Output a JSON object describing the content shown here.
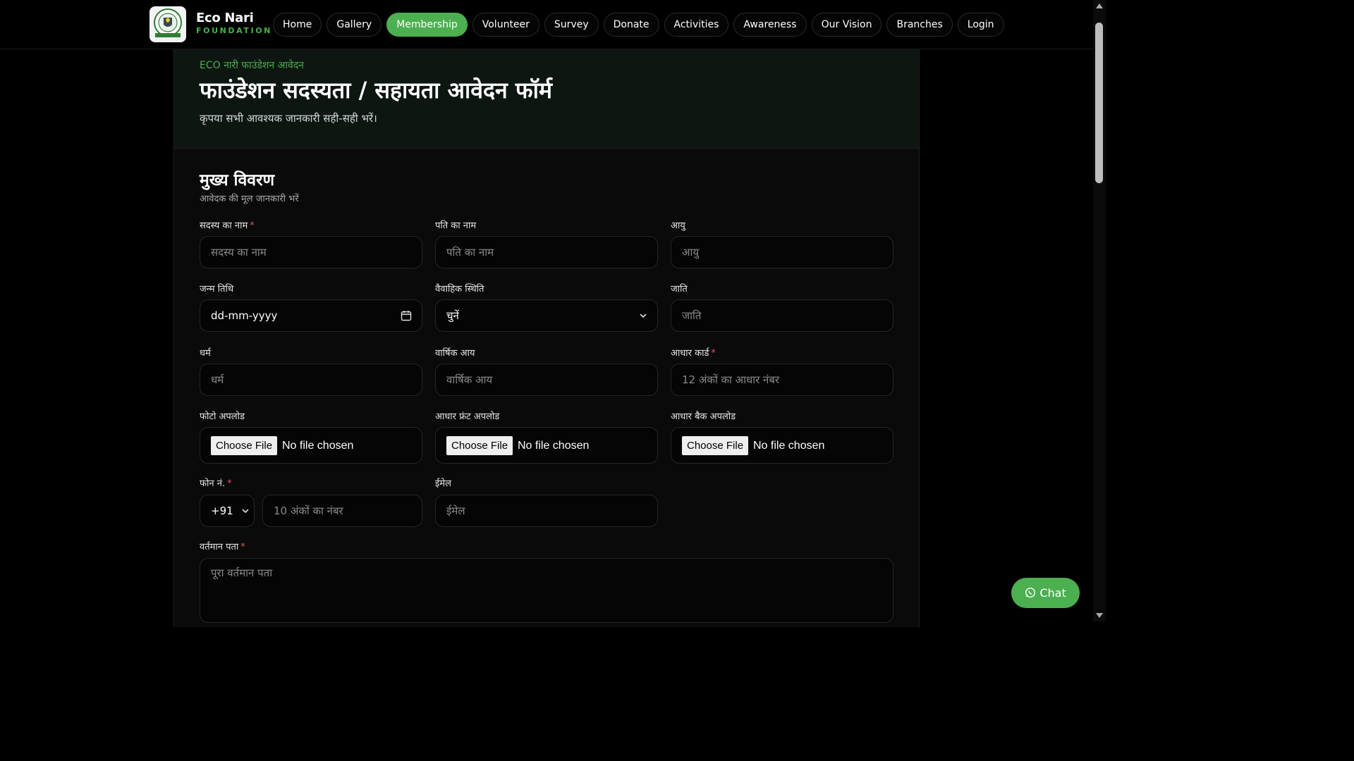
{
  "brand": {
    "name": "Eco Nari",
    "sub": "FOUNDATION",
    "accent": "#4caf50"
  },
  "nav": [
    {
      "label": "Home"
    },
    {
      "label": "Gallery"
    },
    {
      "label": "Membership",
      "active": true
    },
    {
      "label": "Volunteer"
    },
    {
      "label": "Survey"
    },
    {
      "label": "Donate"
    },
    {
      "label": "Activities"
    },
    {
      "label": "Awareness"
    },
    {
      "label": "Our Vision"
    },
    {
      "label": "Branches"
    },
    {
      "label": "Login"
    }
  ],
  "hero": {
    "kicker": "ECO नारी फाउंडेशन आवेदन",
    "title": "फाउंडेशन सदस्यता / सहायता आवेदन फॉर्म",
    "subtitle": "कृपया सभी आवश्यक जानकारी सही-सही भरें।"
  },
  "section": {
    "title": "मुख्य विवरण",
    "subtitle": "आवेदक की मूल जानकारी भरें"
  },
  "fields": {
    "member_name": {
      "label": "सदस्य का नाम",
      "required": "*",
      "placeholder": "सदस्य का नाम"
    },
    "husband_name": {
      "label": "पति का नाम",
      "placeholder": "पति का नाम"
    },
    "age": {
      "label": "आयु",
      "placeholder": "आयु"
    },
    "dob": {
      "label": "जन्म तिथि",
      "value": "dd-mm-yyyy"
    },
    "marital": {
      "label": "वैवाहिक स्थिति",
      "value": "चुनें"
    },
    "caste": {
      "label": "जाति",
      "placeholder": "जाति"
    },
    "religion": {
      "label": "धर्म",
      "placeholder": "धर्म"
    },
    "income": {
      "label": "वार्षिक आय",
      "placeholder": "वार्षिक आय"
    },
    "aadhar": {
      "label": "आधार कार्ड",
      "required": "*",
      "placeholder": "12 अंकों का आधार नंबर"
    },
    "photo": {
      "label": "फोटो अपलोड",
      "button": "Choose File",
      "status": "No file chosen"
    },
    "aadhar_front": {
      "label": "आधार फ्रंट अपलोड",
      "button": "Choose File",
      "status": "No file chosen"
    },
    "aadhar_back": {
      "label": "आधार बैक अपलोड",
      "button": "Choose File",
      "status": "No file chosen"
    },
    "phone": {
      "label": "फोन नं.",
      "required": "*",
      "code": "+91",
      "placeholder": "10 अंकों का नंबर"
    },
    "email": {
      "label": "ईमेल",
      "placeholder": "ईमेल"
    },
    "address": {
      "label": "वर्तमान पता",
      "required": "*",
      "placeholder": "पूरा वर्तमान पता"
    }
  },
  "chat": {
    "label": "Chat"
  }
}
